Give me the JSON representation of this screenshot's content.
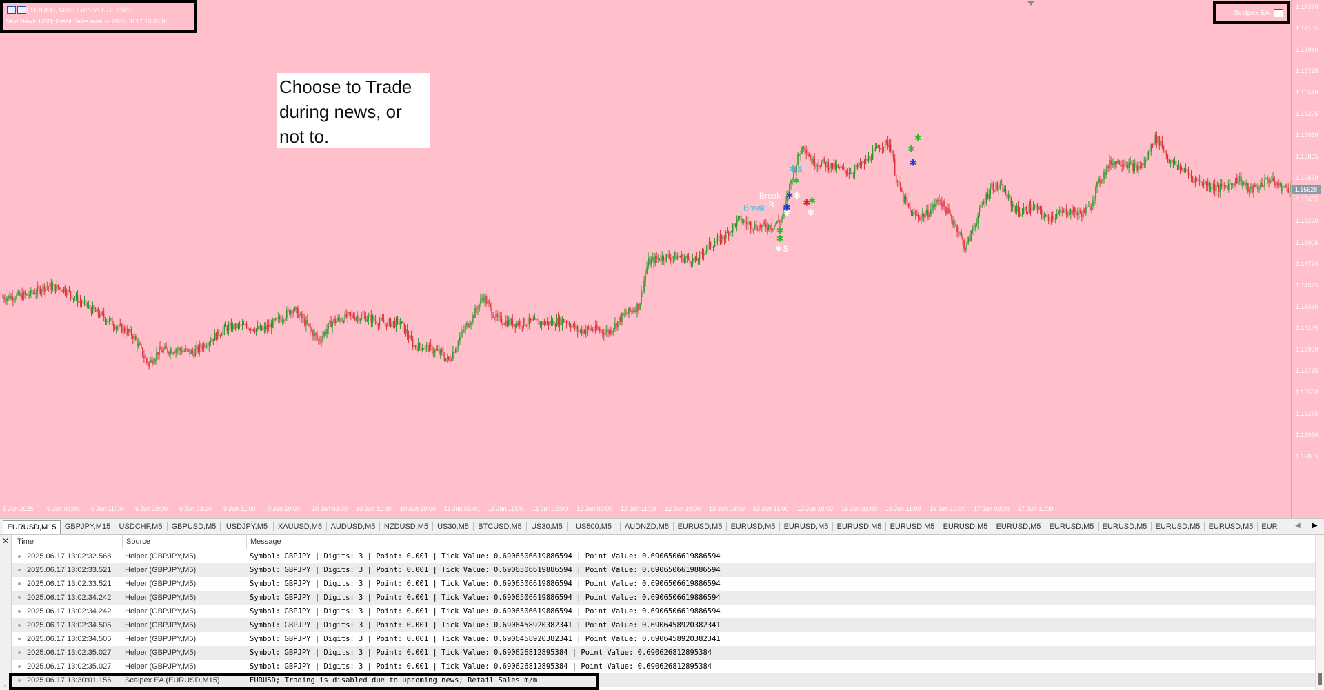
{
  "window": {
    "symbol_line": "EURUSD, M15:  Euro vs US Dollar",
    "news_line": "Next News: USD; Retail Sales m/m -> 2025.06.17 13:30:00"
  },
  "ea_badge": {
    "label": "Scalpex EA",
    "icon": "graduation-cap-icon"
  },
  "annotation": {
    "text": "Choose to Trade during news, or not to."
  },
  "colors": {
    "chart_bg": "#ffc0cb",
    "bull": "#2e9a2e",
    "bear": "#e0333d",
    "price_line": "#8a9aa8"
  },
  "chart_data": {
    "type": "candlestick",
    "symbol": "EURUSD",
    "timeframe": "M15",
    "ylim": [
      1.1264,
      1.1737
    ],
    "y_ticks": [
      "1.17370",
      "1.17155",
      "1.16940",
      "1.16725",
      "1.16510",
      "1.16295",
      "1.16080",
      "1.15865",
      "1.15650",
      "1.15435",
      "1.15220",
      "1.15005",
      "1.14790",
      "1.14575",
      "1.14360",
      "1.14145",
      "1.13930",
      "1.13715",
      "1.13500",
      "1.13285",
      "1.13070",
      "1.12855"
    ],
    "current_price": "1.15628",
    "x_ticks": [
      "5 Jun 2025",
      "6 Jun 03:00",
      "6 Jun 11:00",
      "6 Jun 19:00",
      "9 Jun 03:00",
      "9 Jun 11:00",
      "9 Jun 19:00",
      "10 Jun 03:00",
      "10 Jun 11:00",
      "10 Jun 19:00",
      "11 Jun 03:00",
      "11 Jun 11:00",
      "11 Jun 19:00",
      "12 Jun 03:00",
      "12 Jun 11:00",
      "12 Jun 19:00",
      "13 Jun 03:00",
      "13 Jun 11:00",
      "13 Jun 19:00",
      "16 Jun 03:00",
      "16 Jun 11:00",
      "16 Jun 19:00",
      "17 Jun 03:00",
      "17 Jun 11:00"
    ],
    "path_keypoints": [
      [
        0,
        1.1446
      ],
      [
        28,
        1.1448
      ],
      [
        50,
        1.1457
      ],
      [
        70,
        1.1455
      ],
      [
        90,
        1.1441
      ],
      [
        110,
        1.143
      ],
      [
        130,
        1.1418
      ],
      [
        150,
        1.1408
      ],
      [
        160,
        1.1392
      ],
      [
        168,
        1.1378
      ],
      [
        180,
        1.1392
      ],
      [
        200,
        1.1394
      ],
      [
        220,
        1.139
      ],
      [
        240,
        1.1404
      ],
      [
        260,
        1.1416
      ],
      [
        280,
        1.1417
      ],
      [
        300,
        1.1413
      ],
      [
        320,
        1.1424
      ],
      [
        335,
        1.1435
      ],
      [
        350,
        1.142
      ],
      [
        365,
        1.1402
      ],
      [
        380,
        1.1421
      ],
      [
        400,
        1.1427
      ],
      [
        420,
        1.1426
      ],
      [
        440,
        1.142
      ],
      [
        460,
        1.142
      ],
      [
        475,
        1.1397
      ],
      [
        490,
        1.1395
      ],
      [
        505,
        1.139
      ],
      [
        515,
        1.1382
      ],
      [
        530,
        1.1409
      ],
      [
        545,
        1.143
      ],
      [
        555,
        1.1447
      ],
      [
        570,
        1.1424
      ],
      [
        590,
        1.142
      ],
      [
        610,
        1.1421
      ],
      [
        630,
        1.142
      ],
      [
        650,
        1.1423
      ],
      [
        665,
        1.1412
      ],
      [
        680,
        1.1414
      ],
      [
        700,
        1.1411
      ],
      [
        715,
        1.1426
      ],
      [
        735,
        1.1438
      ],
      [
        745,
        1.1481
      ],
      [
        760,
        1.1486
      ],
      [
        780,
        1.1487
      ],
      [
        800,
        1.1482
      ],
      [
        815,
        1.1497
      ],
      [
        835,
        1.1508
      ],
      [
        850,
        1.1524
      ],
      [
        870,
        1.1517
      ],
      [
        890,
        1.1518
      ],
      [
        900,
        1.1525
      ],
      [
        910,
        1.1562
      ],
      [
        918,
        1.1585
      ],
      [
        925,
        1.16
      ],
      [
        935,
        1.1582
      ],
      [
        950,
        1.158
      ],
      [
        965,
        1.1575
      ],
      [
        980,
        1.1572
      ],
      [
        995,
        1.1581
      ],
      [
        1005,
        1.159
      ],
      [
        1015,
        1.16
      ],
      [
        1025,
        1.16
      ],
      [
        1032,
        1.1565
      ],
      [
        1040,
        1.1545
      ],
      [
        1050,
        1.153
      ],
      [
        1058,
        1.1527
      ],
      [
        1068,
        1.153
      ],
      [
        1082,
        1.1545
      ],
      [
        1092,
        1.153
      ],
      [
        1103,
        1.1515
      ],
      [
        1112,
        1.1495
      ],
      [
        1122,
        1.1518
      ],
      [
        1132,
        1.154
      ],
      [
        1142,
        1.1558
      ],
      [
        1155,
        1.1555
      ],
      [
        1165,
        1.154
      ],
      [
        1175,
        1.153
      ],
      [
        1185,
        1.1536
      ],
      [
        1195,
        1.1535
      ],
      [
        1205,
        1.1525
      ],
      [
        1215,
        1.1528
      ],
      [
        1230,
        1.1533
      ],
      [
        1245,
        1.153
      ],
      [
        1255,
        1.1535
      ],
      [
        1265,
        1.156
      ],
      [
        1280,
        1.1582
      ],
      [
        1295,
        1.1582
      ],
      [
        1310,
        1.1575
      ],
      [
        1320,
        1.1582
      ],
      [
        1330,
        1.1606
      ],
      [
        1338,
        1.1601
      ],
      [
        1348,
        1.1582
      ],
      [
        1360,
        1.1577
      ],
      [
        1375,
        1.1565
      ],
      [
        1390,
        1.156
      ],
      [
        1405,
        1.1555
      ],
      [
        1418,
        1.156
      ],
      [
        1428,
        1.1565
      ],
      [
        1440,
        1.1553
      ],
      [
        1450,
        1.1557
      ],
      [
        1462,
        1.1565
      ],
      [
        1475,
        1.1557
      ],
      [
        1485,
        1.1555
      ],
      [
        1497,
        1.1562
      ]
    ],
    "markers": [
      {
        "x": 1152,
        "y": 1.1572,
        "color": "#2ec6e6",
        "label": "$"
      },
      {
        "x": 1157,
        "y": 1.156,
        "color": "#2eb82e"
      },
      {
        "x": 1158,
        "y": 1.1545,
        "color": "#ffffff"
      },
      {
        "x": 1172,
        "y": 1.1538,
        "color": "#d22222"
      },
      {
        "x": 1180,
        "y": 1.154,
        "color": "#2eb82e"
      },
      {
        "x": 1143,
        "y": 1.1528,
        "color": "#ffffff"
      },
      {
        "x": 1133,
        "y": 1.151,
        "color": "#2eb82e"
      },
      {
        "x": 1133,
        "y": 1.1502,
        "color": "#2eb82e"
      },
      {
        "x": 1131,
        "y": 1.1492,
        "color": "#ffffff",
        "label": "$"
      },
      {
        "x": 1178,
        "y": 1.1528,
        "color": "#ffffff"
      },
      {
        "x": 1335,
        "y": 1.1603,
        "color": "#2eb82e"
      },
      {
        "x": 1325,
        "y": 1.1592,
        "color": "#2eb82e"
      },
      {
        "x": 1328,
        "y": 1.1578,
        "color": "#1f3fd0"
      },
      {
        "x": 1143,
        "y": 1.1533,
        "color": "#1f3fd0"
      },
      {
        "x": 1147,
        "y": 1.1545,
        "color": "#1f3fd0"
      }
    ],
    "annotations": [
      {
        "text": "Break",
        "x": 1108,
        "y": 1.1545,
        "color": "#ffffff"
      },
      {
        "text": "Break",
        "x": 1085,
        "y": 1.1533,
        "color": "#2ec6e6"
      },
      {
        "text": "B",
        "x": 1122,
        "y": 1.1536,
        "color": "#ffffff"
      }
    ]
  },
  "tabs": [
    {
      "label": "EURUSD,M15",
      "active": true
    },
    {
      "label": "GBPJPY,M15"
    },
    {
      "label": "USDCHF,M5"
    },
    {
      "label": "GBPUSD,M5"
    },
    {
      "label": "USDJPY,M5"
    },
    {
      "label": "XAUUSD,M5"
    },
    {
      "label": "AUDUSD,M5"
    },
    {
      "label": "NZDUSD,M5"
    },
    {
      "label": "US30,M5"
    },
    {
      "label": "BTCUSD,M5"
    },
    {
      "label": "US30,M5"
    },
    {
      "label": "US500,M5"
    },
    {
      "label": "AUDNZD,M5"
    },
    {
      "label": "EURUSD,M5"
    },
    {
      "label": "EURUSD,M5"
    },
    {
      "label": "EURUSD,M5"
    },
    {
      "label": "EURUSD,M5"
    },
    {
      "label": "EURUSD,M5"
    },
    {
      "label": "EURUSD,M5"
    },
    {
      "label": "EURUSD,M5"
    },
    {
      "label": "EURUSD,M5"
    },
    {
      "label": "EURUSD,M5"
    },
    {
      "label": "EURUSD,M5"
    },
    {
      "label": "EURUSD,M5"
    },
    {
      "label": "EUR"
    }
  ],
  "log": {
    "columns": {
      "time": "Time",
      "source": "Source",
      "message": "Message"
    },
    "rows": [
      {
        "time": "2025.06.17 13:02:32.568",
        "source": "Helper (GBPJPY,M5)",
        "message": "Symbol: GBPJPY | Digits: 3 | Point: 0.001 | Tick Value: 0.6906506619886594 | Point Value: 0.6906506619886594"
      },
      {
        "time": "2025.06.17 13:02:33.521",
        "source": "Helper (GBPJPY,M5)",
        "message": "Symbol: GBPJPY | Digits: 3 | Point: 0.001 | Tick Value: 0.6906506619886594 | Point Value: 0.6906506619886594"
      },
      {
        "time": "2025.06.17 13:02:33.521",
        "source": "Helper (GBPJPY,M5)",
        "message": "Symbol: GBPJPY | Digits: 3 | Point: 0.001 | Tick Value: 0.6906506619886594 | Point Value: 0.6906506619886594"
      },
      {
        "time": "2025.06.17 13:02:34.242",
        "source": "Helper (GBPJPY,M5)",
        "message": "Symbol: GBPJPY | Digits: 3 | Point: 0.001 | Tick Value: 0.6906506619886594 | Point Value: 0.6906506619886594"
      },
      {
        "time": "2025.06.17 13:02:34.242",
        "source": "Helper (GBPJPY,M5)",
        "message": "Symbol: GBPJPY | Digits: 3 | Point: 0.001 | Tick Value: 0.6906506619886594 | Point Value: 0.6906506619886594"
      },
      {
        "time": "2025.06.17 13:02:34.505",
        "source": "Helper (GBPJPY,M5)",
        "message": "Symbol: GBPJPY | Digits: 3 | Point: 0.001 | Tick Value: 0.6906458920382341 | Point Value: 0.6906458920382341"
      },
      {
        "time": "2025.06.17 13:02:34.505",
        "source": "Helper (GBPJPY,M5)",
        "message": "Symbol: GBPJPY | Digits: 3 | Point: 0.001 | Tick Value: 0.6906458920382341 | Point Value: 0.6906458920382341"
      },
      {
        "time": "2025.06.17 13:02:35.027",
        "source": "Helper (GBPJPY,M5)",
        "message": "Symbol: GBPJPY | Digits: 3 | Point: 0.001 | Tick Value: 0.690626812895384 | Point Value: 0.690626812895384"
      },
      {
        "time": "2025.06.17 13:02:35.027",
        "source": "Helper (GBPJPY,M5)",
        "message": "Symbol: GBPJPY | Digits: 3 | Point: 0.001 | Tick Value: 0.690626812895384 | Point Value: 0.690626812895384"
      },
      {
        "time": "2025.06.17 13:30:01.156",
        "source": "Scalpex EA (EURUSD,M15)",
        "message": "EURUSD; Trading is disabled due to upcoming news; Retail Sales m/m"
      }
    ]
  }
}
